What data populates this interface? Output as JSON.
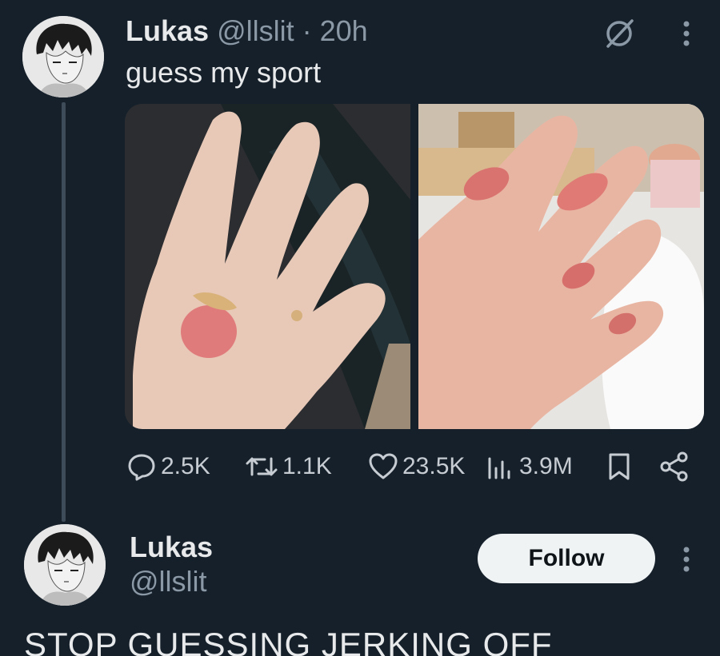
{
  "tweet": {
    "author_name": "Lukas",
    "author_handle": "@llslit",
    "separator": "·",
    "time": "20h",
    "text": "guess my sport",
    "media": [
      {
        "alt": "hand-photo-1"
      },
      {
        "alt": "hand-photo-2"
      }
    ],
    "stats": {
      "replies": "2.5K",
      "retweets": "1.1K",
      "likes": "23.5K",
      "views": "3.9M"
    }
  },
  "user_card": {
    "name": "Lukas",
    "handle": "@llslit",
    "follow_label": "Follow"
  },
  "bottom_text": "STOP GUESSING JERKING OFF",
  "icons": {
    "grok": "grok-icon",
    "more": "more-vertical-icon",
    "reply": "reply-icon",
    "retweet": "retweet-icon",
    "like": "heart-icon",
    "views": "views-icon",
    "bookmark": "bookmark-icon",
    "share": "share-icon"
  },
  "colors": {
    "background": "#15202b",
    "text_primary": "#e7e9ea",
    "text_secondary": "#8b98a5",
    "follow_button_bg": "#eff3f4"
  }
}
